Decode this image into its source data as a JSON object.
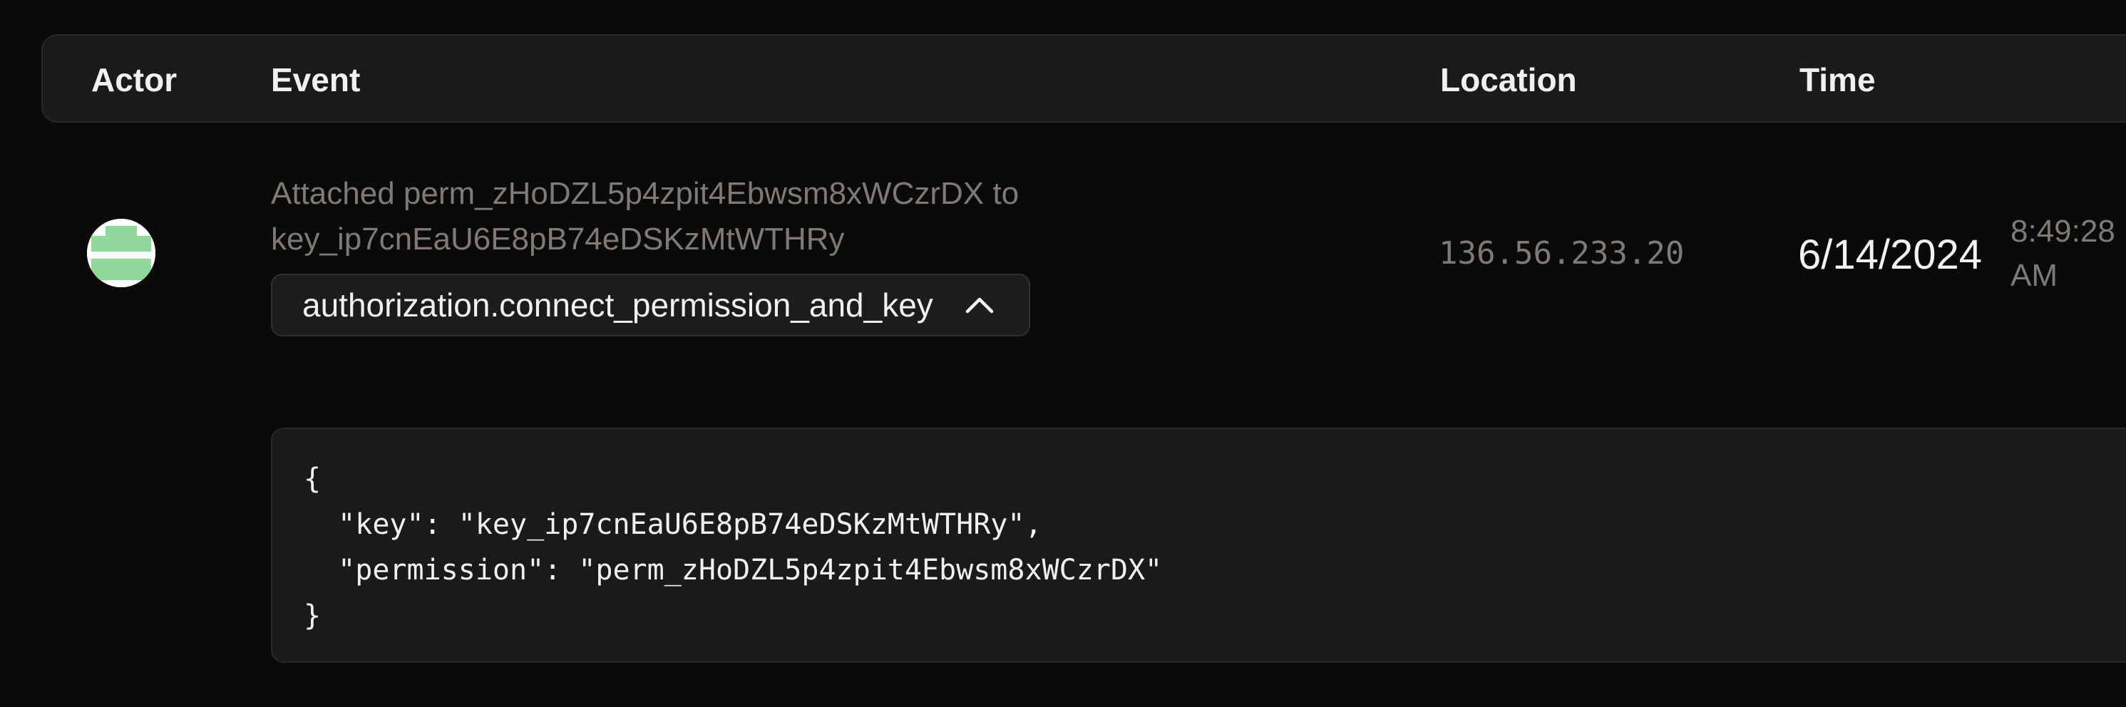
{
  "table": {
    "columns": {
      "actor": "Actor",
      "event": "Event",
      "location": "Location",
      "time": "Time"
    }
  },
  "row": {
    "avatar_icon": "root-key-avatar-icon",
    "event_description_line1": "Attached perm_zHoDZL5p4zpit4Ebwsm8xWCzrDX to",
    "event_description_line2": "key_ip7cnEaU6E8pB74eDSKzMtWTHRy",
    "event_type": "authorization.connect_permission_and_key",
    "toggle_icon": "chevron-up-icon",
    "location": "136.56.233.20",
    "date": "6/14/2024",
    "time_line1": "8:49:28",
    "time_line2": "AM",
    "payload": "{\n  \"key\": \"key_ip7cnEaU6E8pB74eDSKzMtWTHRy\",\n  \"permission\": \"perm_zHoDZL5p4zpit4Ebwsm8xWCzrDX\"\n}"
  },
  "colors": {
    "background": "#0b0a09",
    "panel": "#1c1a18",
    "text_primary": "#f2f0ee",
    "text_muted": "#7d7a77",
    "avatar_green": "#8fd99a"
  }
}
